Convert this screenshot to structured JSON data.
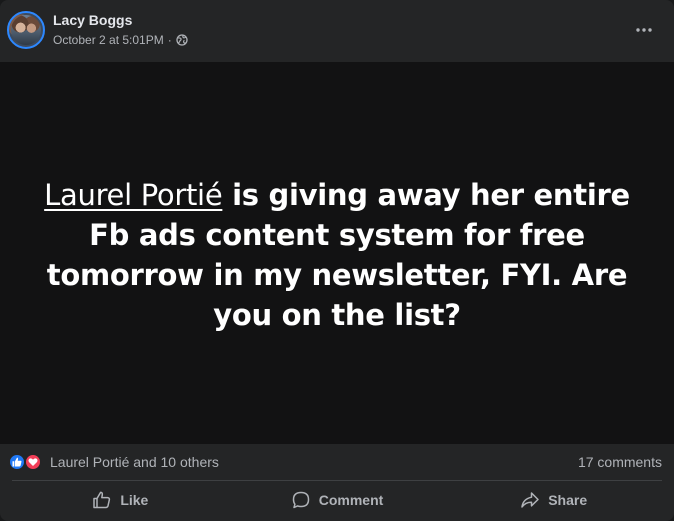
{
  "post": {
    "author": "Lacy Boggs",
    "timestamp": "October 2 at 5:01PM",
    "separator": "·",
    "privacy_icon": "globe-icon",
    "more_icon": "more-horizontal-icon"
  },
  "media": {
    "mention": "Laurel Portié",
    "text": " is giving away her entire Fb ads content system for free tomorrow in my newsletter, FYI. Are you on the list?",
    "background": "#121213",
    "text_color": "#ffffff"
  },
  "reactions": {
    "icons": [
      "like-icon",
      "love-icon"
    ],
    "names": "Laurel Portié and 10 others",
    "comments": "17 comments"
  },
  "actions": {
    "like_label": "Like",
    "comment_label": "Comment",
    "share_label": "Share"
  },
  "colors": {
    "card_bg": "#242526",
    "secondary_text": "#b0b3b8",
    "like_blue": "#2078f4",
    "love_red": "#f33e58",
    "avatar_ring": "#2d88ff"
  }
}
